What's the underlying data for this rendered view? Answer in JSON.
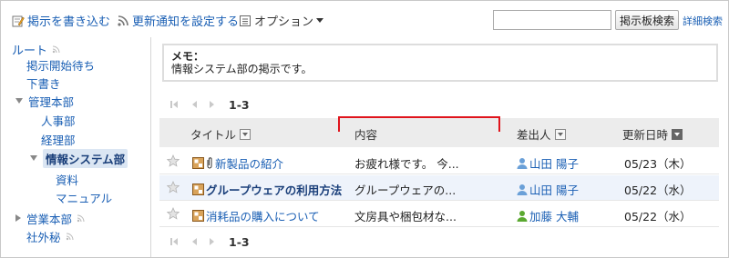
{
  "toolbar": {
    "write_label": "掲示を書き込む",
    "notify_label": "更新通知を設定する",
    "option_label": "オプション",
    "search_value": "",
    "search_button": "掲示板検索",
    "advanced_search": "詳細検索"
  },
  "sidebar": {
    "root": "ルート",
    "items": [
      {
        "label": "掲示開始待ち"
      },
      {
        "label": "下書き"
      },
      {
        "label": "管理本部"
      },
      {
        "label": "人事部"
      },
      {
        "label": "経理部"
      },
      {
        "label": "情報システム部"
      },
      {
        "label": "資料"
      },
      {
        "label": "マニュアル"
      },
      {
        "label": "営業本部"
      },
      {
        "label": "社外秘"
      }
    ]
  },
  "memo": {
    "title": "メモ：",
    "text": "情報システム部の掲示です。"
  },
  "pager": {
    "range": "1-3"
  },
  "table": {
    "headers": {
      "title": "タイトル",
      "content": "内容",
      "sender": "差出人",
      "updated": "更新日時"
    },
    "rows": [
      {
        "title": "新製品の紹介",
        "content": "お疲れ様です。 今...",
        "sender": "山田 陽子",
        "date": "05/23（木）",
        "unread": false,
        "attachment": true,
        "sender_color": "#6aa0d8"
      },
      {
        "title": "グループウェアの利用方法",
        "content": "グループウェアの...",
        "sender": "山田 陽子",
        "date": "05/22（水）",
        "unread": true,
        "attachment": false,
        "sender_color": "#6aa0d8"
      },
      {
        "title": "消耗品の購入について",
        "content": "文房具や梱包材な...",
        "sender": "加藤 大輔",
        "date": "05/22（水）",
        "unread": false,
        "attachment": false,
        "sender_color": "#5aa830"
      }
    ]
  },
  "colors": {
    "link": "#1a5fb4",
    "highlight": "#e0141c",
    "unread_bg": "#eef3fb"
  }
}
